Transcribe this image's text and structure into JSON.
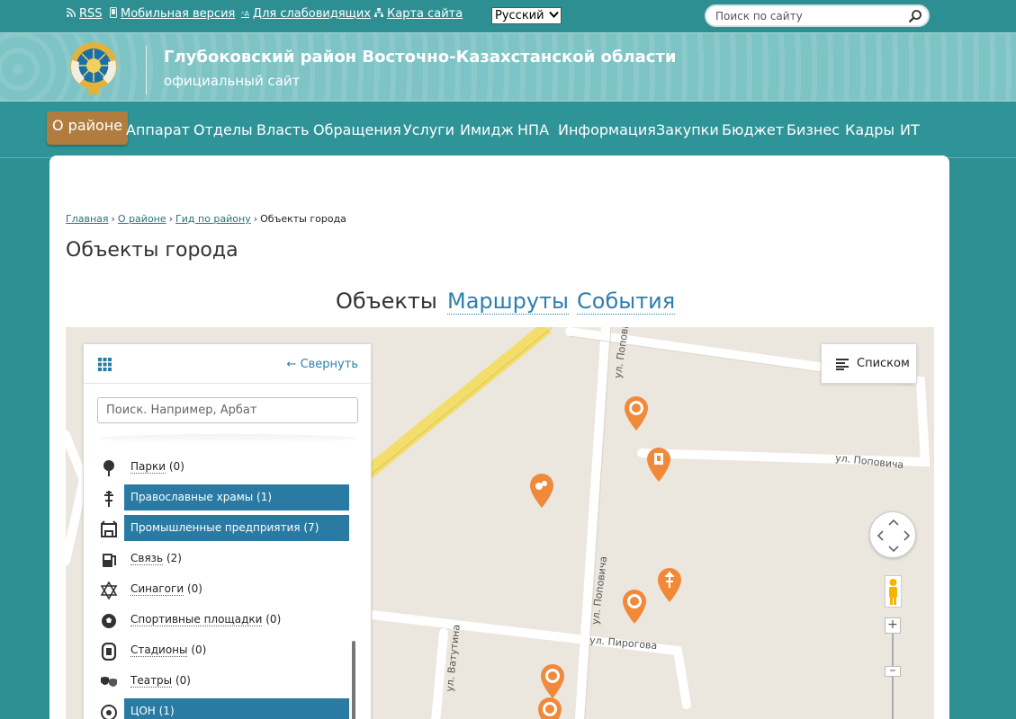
{
  "topbar": {
    "rss": "RSS",
    "mobile": "Мобильная версия",
    "low_vision": "Для слабовидящих",
    "sitemap": "Карта сайта",
    "language": "Русский",
    "search_placeholder": "Поиск по сайту"
  },
  "header": {
    "title": "Глубоковский район Восточно-Казахстанской области",
    "subtitle": "официальный сайт"
  },
  "nav": {
    "items": [
      "О районе",
      "Аппарат",
      "Отделы",
      "Власть",
      "Обращения",
      "Услуги",
      "Имидж",
      "НПА",
      "Информация",
      "Закупки",
      "Бюджет",
      "Бизнес",
      "Кадры",
      "ИТ"
    ],
    "active": "О районе"
  },
  "breadcrumb": {
    "items": [
      "Главная",
      "О районе",
      "Гид по району"
    ],
    "current": "Объекты города"
  },
  "page_title": "Объекты города",
  "tabs": [
    "Объекты",
    "Маршруты",
    "События"
  ],
  "map": {
    "collapse_label": "← Свернуть",
    "search_placeholder": "Поиск. Например, Арбат",
    "list_button": "Списком",
    "categories": [
      {
        "name": "Парки",
        "count": "(0)",
        "icon": "tree-icon",
        "selected": false
      },
      {
        "name": "Православные храмы",
        "count": "(1)",
        "icon": "orthodox-cross-icon",
        "selected": true
      },
      {
        "name": "Промышленные предприятия",
        "count": "(7)",
        "icon": "factory-icon",
        "selected": true
      },
      {
        "name": "Связь",
        "count": "(2)",
        "icon": "phone-icon",
        "selected": false
      },
      {
        "name": "Синагоги",
        "count": "(0)",
        "icon": "star-of-david-icon",
        "selected": false
      },
      {
        "name": "Спортивные площадки",
        "count": "(0)",
        "icon": "ball-icon",
        "selected": false
      },
      {
        "name": "Стадионы",
        "count": "(0)",
        "icon": "stadium-icon",
        "selected": false
      },
      {
        "name": "Театры",
        "count": "(0)",
        "icon": "theatre-masks-icon",
        "selected": false
      },
      {
        "name": "ЦОН",
        "count": "(1)",
        "icon": "emblem-icon",
        "selected": true
      }
    ],
    "streets": [
      "ул. Поповича",
      "ул. Поповича",
      "ул. Поповича",
      "ул. Пирогова",
      "ул. Ватутина"
    ],
    "marker_color": "#f0893a"
  }
}
